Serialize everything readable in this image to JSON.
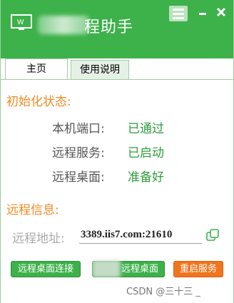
{
  "window": {
    "title": "远程助手",
    "title_visible_suffix": "远程助手",
    "colors": {
      "titlebar": "#3db14a",
      "accent_orange": "#ef8b22",
      "status_green": "#2d9c3a"
    }
  },
  "controls": {
    "menu_icon": "hamburger-menu",
    "minimize_icon": "minus",
    "close_icon": "x"
  },
  "tabs": [
    {
      "label": "主页",
      "active": true
    },
    {
      "label": "使用说明",
      "active": false
    }
  ],
  "init_status": {
    "title": "初始化状态:",
    "rows": [
      {
        "label": "本机端口:",
        "value": "已通过"
      },
      {
        "label": "远程服务:",
        "value": "已启动"
      },
      {
        "label": "远程桌面:",
        "value": "准备好"
      }
    ]
  },
  "remote_info": {
    "title": "远程信息:",
    "address_label": "远程地址:",
    "address_value": "3389.iis7.com:21610"
  },
  "buttons": {
    "connect": "远程桌面连接",
    "middle": "远程桌面",
    "restart": "重启服务"
  },
  "watermark": "CSDN @三十三 _"
}
